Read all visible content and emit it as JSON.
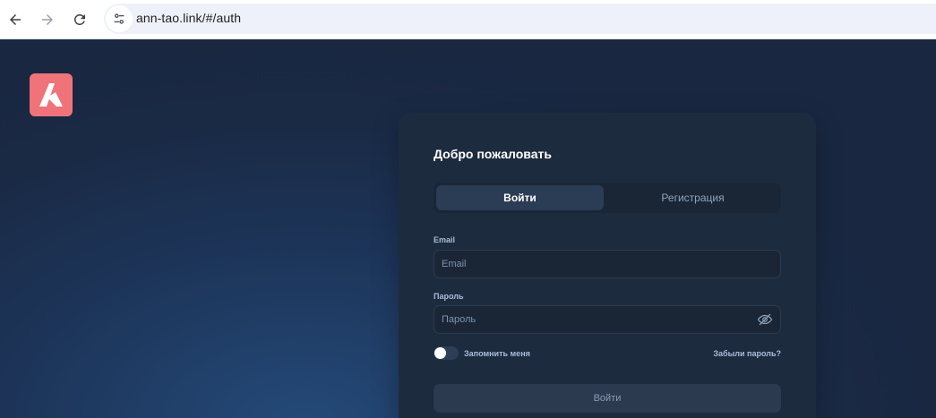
{
  "browser": {
    "url": "ann-tao.link/#/auth",
    "back_icon": "arrow-left-icon",
    "forward_icon": "arrow-right-icon",
    "reload_icon": "reload-icon",
    "site_info_icon": "tune-icon"
  },
  "brand": {
    "logo_icon": "brand-logo-icon",
    "logo_color": "#f0737a"
  },
  "auth": {
    "title": "Добро пожаловать",
    "tabs": {
      "login": "Войти",
      "register": "Регистрация"
    },
    "email": {
      "label": "Email",
      "placeholder": "Email",
      "value": ""
    },
    "password": {
      "label": "Пароль",
      "placeholder": "Пароль",
      "value": "",
      "toggle_icon": "eye-off-icon"
    },
    "remember": {
      "label": "Запомнить меня",
      "checked": false
    },
    "forgot_link": "Забыли пароль?",
    "submit_label": "Войти"
  },
  "colors": {
    "background": "#1d355a",
    "card": "#1d2b3e",
    "active_tab": "#2b3c55",
    "label": "#a9bdd8"
  }
}
